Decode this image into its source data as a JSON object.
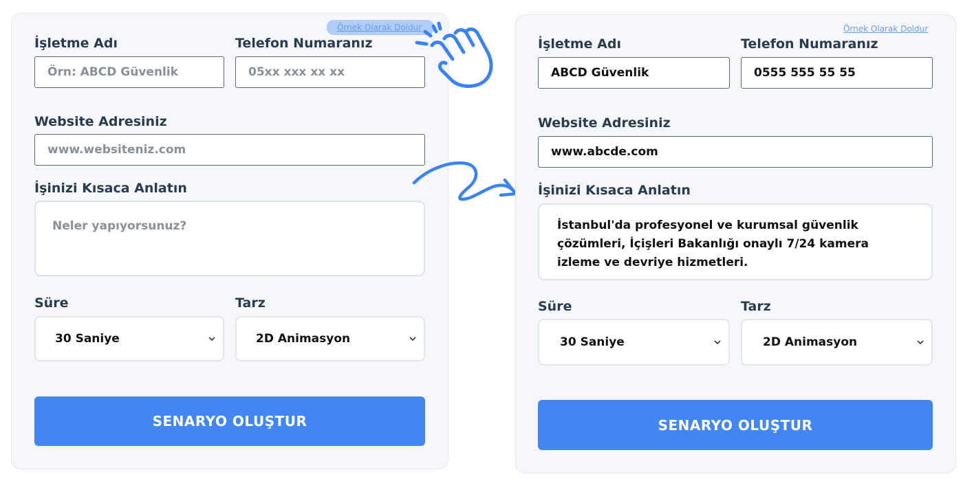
{
  "form_before": {
    "example_link": "Örnek Olarak Doldur",
    "business_name": {
      "label": "İşletme Adı",
      "placeholder": "Örn: ABCD Güvenlik"
    },
    "phone": {
      "label": "Telefon Numaranız",
      "placeholder": "05xx xxx xx xx"
    },
    "website": {
      "label": "Website Adresiniz",
      "placeholder": "www.websiteniz.com"
    },
    "description": {
      "label": "İşinizi Kısaca Anlatın",
      "placeholder": "Neler yapıyorsunuz?"
    },
    "duration": {
      "label": "Süre",
      "value": "30 Saniye"
    },
    "style": {
      "label": "Tarz",
      "value": "2D Animasyon"
    },
    "submit_label": "SENARYO OLUŞTUR"
  },
  "form_after": {
    "example_link": "Örnek Olarak Doldur",
    "business_name": {
      "label": "İşletme Adı",
      "value": "ABCD Güvenlik"
    },
    "phone": {
      "label": "Telefon Numaranız",
      "value": "0555 555 55 55"
    },
    "website": {
      "label": "Website Adresiniz",
      "value": "www.abcde.com"
    },
    "description": {
      "label": "İşinizi Kısaca Anlatın",
      "value": "İstanbul'da profesyonel ve kurumsal güvenlik çözümleri, İçişleri Bakanlığı onaylı 7/24 kamera izleme ve devriye hizmetleri."
    },
    "duration": {
      "label": "Süre",
      "value": "30 Saniye"
    },
    "style": {
      "label": "Tarz",
      "value": "2D Animasyon"
    },
    "submit_label": "SENARYO OLUŞTUR"
  },
  "colors": {
    "accent": "#4286f4",
    "card_background": "#f5f7fa",
    "link": "#6a9de8",
    "annotation": "#3b82f6"
  },
  "icons": {
    "cursor": "hand-pointer-icon",
    "arrow": "curved-arrow-icon",
    "chevron": "chevron-down-icon"
  }
}
